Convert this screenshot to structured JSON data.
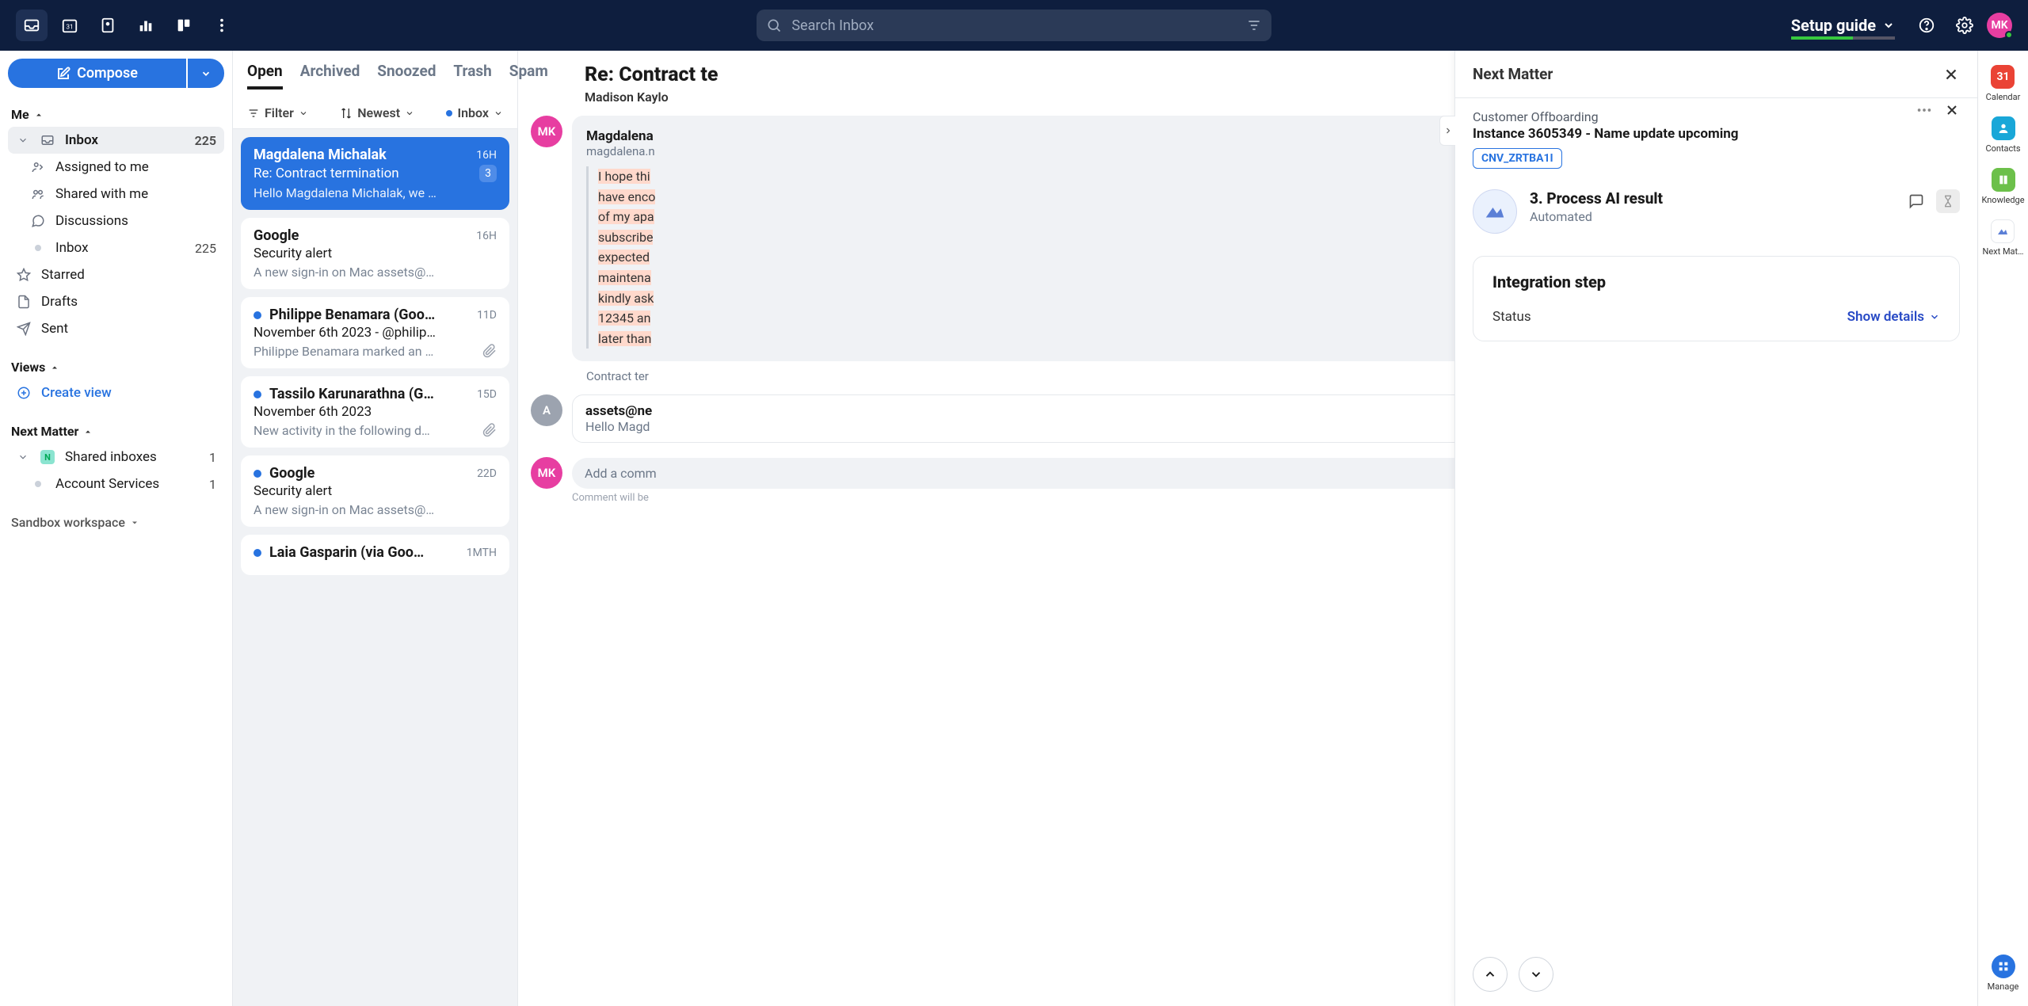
{
  "topbar": {
    "search_placeholder": "Search Inbox",
    "setup_guide": "Setup guide",
    "avatar": "MK"
  },
  "compose": {
    "label": "Compose"
  },
  "sidebar": {
    "section_me": "Me",
    "inbox": {
      "label": "Inbox",
      "count": "225"
    },
    "assigned": "Assigned to me",
    "shared": "Shared with me",
    "discussions": "Discussions",
    "inbox2": {
      "label": "Inbox",
      "count": "225"
    },
    "starred": "Starred",
    "drafts": "Drafts",
    "sent": "Sent",
    "section_views": "Views",
    "create_view": "Create view",
    "section_nm": "Next Matter",
    "shared_inboxes": {
      "label": "Shared inboxes",
      "count": "1"
    },
    "account_services": {
      "label": "Account Services",
      "count": "1"
    },
    "workspace": "Sandbox workspace"
  },
  "tabs": {
    "open": "Open",
    "archived": "Archived",
    "snoozed": "Snoozed",
    "trash": "Trash",
    "spam": "Spam"
  },
  "controls": {
    "filter": "Filter",
    "newest": "Newest",
    "inbox": "Inbox"
  },
  "threads": [
    {
      "sender": "Magdalena Michalak",
      "time": "16H",
      "subject": "Re: Contract termination",
      "preview": "Hello Magdalena Michalak, we …",
      "badge": "3",
      "selected": true,
      "unread": false,
      "attach": false
    },
    {
      "sender": "Google",
      "time": "16H",
      "subject": "Security alert",
      "preview": "A new sign-in on Mac assets@…",
      "unread": false,
      "attach": false
    },
    {
      "sender": "Philippe Benamara (Goo…",
      "time": "11D",
      "subject": "November 6th 2023 - @philip…",
      "preview": "Philippe Benamara marked an …",
      "unread": true,
      "attach": true
    },
    {
      "sender": "Tassilo Karunarathna (G…",
      "time": "15D",
      "subject": "November 6th 2023",
      "preview": "New activity in the following d…",
      "unread": true,
      "attach": true
    },
    {
      "sender": "Google",
      "time": "22D",
      "subject": "Security alert",
      "preview": "A new sign-in on Mac assets@…",
      "unread": true,
      "attach": false
    },
    {
      "sender": "Laia Gasparin (via Goo…",
      "time": "1MTH",
      "subject": "",
      "preview": "",
      "unread": true,
      "attach": false
    }
  ],
  "conversation": {
    "subject": "Re: Contract te",
    "from_line": "Madison Kaylo",
    "msg1": {
      "name": "Magdalena",
      "email": "magdalena.n",
      "body_lines": [
        "I hope thi",
        "have enco",
        "of my apa",
        "subscribe",
        "expected",
        "maintena",
        "kindly ask",
        "12345 an",
        "later than"
      ],
      "footer": "Contract ter"
    },
    "msg2": {
      "name": "assets@ne",
      "preview": "Hello Magd"
    },
    "comment_placeholder": "Add a comm",
    "comment_hint": "Comment will be"
  },
  "overlay": {
    "title": "Next Matter",
    "process": "Customer Offboarding",
    "instance": "Instance 3605349 - Name update upcoming",
    "chip": "CNV_ZRTBA1I",
    "step_title": "3. Process AI result",
    "step_sub": "Automated",
    "card_title": "Integration step",
    "status_label": "Status",
    "show_details": "Show details"
  },
  "rail": {
    "calendar": "Calendar",
    "contacts": "Contacts",
    "knowledge": "Knowledge",
    "nextmatter": "Next Mat…",
    "manage": "Manage"
  }
}
